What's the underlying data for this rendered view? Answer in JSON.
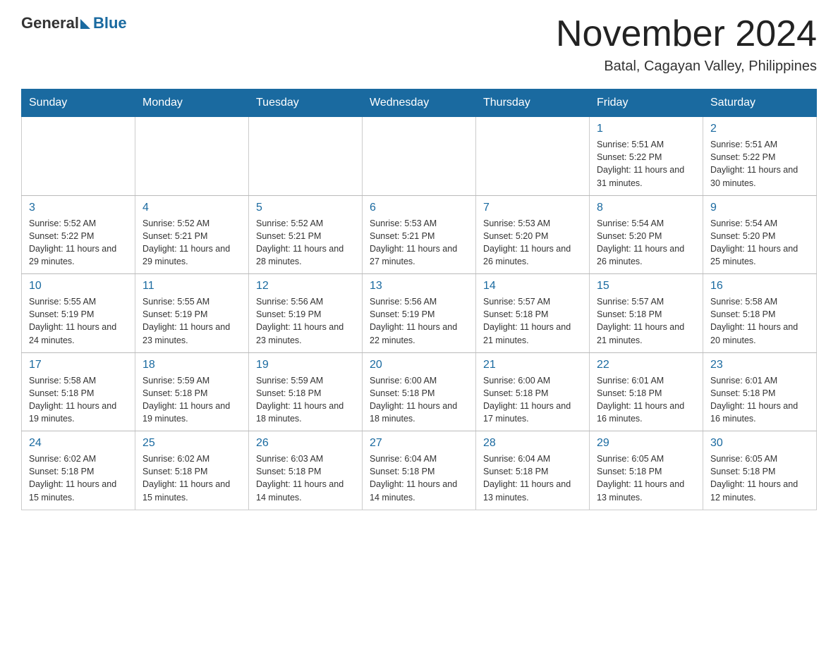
{
  "header": {
    "logo_general": "General",
    "logo_blue": "Blue",
    "month_title": "November 2024",
    "location": "Batal, Cagayan Valley, Philippines"
  },
  "days_of_week": [
    "Sunday",
    "Monday",
    "Tuesday",
    "Wednesday",
    "Thursday",
    "Friday",
    "Saturday"
  ],
  "weeks": [
    [
      {
        "day": "",
        "info": ""
      },
      {
        "day": "",
        "info": ""
      },
      {
        "day": "",
        "info": ""
      },
      {
        "day": "",
        "info": ""
      },
      {
        "day": "",
        "info": ""
      },
      {
        "day": "1",
        "info": "Sunrise: 5:51 AM\nSunset: 5:22 PM\nDaylight: 11 hours and 31 minutes."
      },
      {
        "day": "2",
        "info": "Sunrise: 5:51 AM\nSunset: 5:22 PM\nDaylight: 11 hours and 30 minutes."
      }
    ],
    [
      {
        "day": "3",
        "info": "Sunrise: 5:52 AM\nSunset: 5:22 PM\nDaylight: 11 hours and 29 minutes."
      },
      {
        "day": "4",
        "info": "Sunrise: 5:52 AM\nSunset: 5:21 PM\nDaylight: 11 hours and 29 minutes."
      },
      {
        "day": "5",
        "info": "Sunrise: 5:52 AM\nSunset: 5:21 PM\nDaylight: 11 hours and 28 minutes."
      },
      {
        "day": "6",
        "info": "Sunrise: 5:53 AM\nSunset: 5:21 PM\nDaylight: 11 hours and 27 minutes."
      },
      {
        "day": "7",
        "info": "Sunrise: 5:53 AM\nSunset: 5:20 PM\nDaylight: 11 hours and 26 minutes."
      },
      {
        "day": "8",
        "info": "Sunrise: 5:54 AM\nSunset: 5:20 PM\nDaylight: 11 hours and 26 minutes."
      },
      {
        "day": "9",
        "info": "Sunrise: 5:54 AM\nSunset: 5:20 PM\nDaylight: 11 hours and 25 minutes."
      }
    ],
    [
      {
        "day": "10",
        "info": "Sunrise: 5:55 AM\nSunset: 5:19 PM\nDaylight: 11 hours and 24 minutes."
      },
      {
        "day": "11",
        "info": "Sunrise: 5:55 AM\nSunset: 5:19 PM\nDaylight: 11 hours and 23 minutes."
      },
      {
        "day": "12",
        "info": "Sunrise: 5:56 AM\nSunset: 5:19 PM\nDaylight: 11 hours and 23 minutes."
      },
      {
        "day": "13",
        "info": "Sunrise: 5:56 AM\nSunset: 5:19 PM\nDaylight: 11 hours and 22 minutes."
      },
      {
        "day": "14",
        "info": "Sunrise: 5:57 AM\nSunset: 5:18 PM\nDaylight: 11 hours and 21 minutes."
      },
      {
        "day": "15",
        "info": "Sunrise: 5:57 AM\nSunset: 5:18 PM\nDaylight: 11 hours and 21 minutes."
      },
      {
        "day": "16",
        "info": "Sunrise: 5:58 AM\nSunset: 5:18 PM\nDaylight: 11 hours and 20 minutes."
      }
    ],
    [
      {
        "day": "17",
        "info": "Sunrise: 5:58 AM\nSunset: 5:18 PM\nDaylight: 11 hours and 19 minutes."
      },
      {
        "day": "18",
        "info": "Sunrise: 5:59 AM\nSunset: 5:18 PM\nDaylight: 11 hours and 19 minutes."
      },
      {
        "day": "19",
        "info": "Sunrise: 5:59 AM\nSunset: 5:18 PM\nDaylight: 11 hours and 18 minutes."
      },
      {
        "day": "20",
        "info": "Sunrise: 6:00 AM\nSunset: 5:18 PM\nDaylight: 11 hours and 18 minutes."
      },
      {
        "day": "21",
        "info": "Sunrise: 6:00 AM\nSunset: 5:18 PM\nDaylight: 11 hours and 17 minutes."
      },
      {
        "day": "22",
        "info": "Sunrise: 6:01 AM\nSunset: 5:18 PM\nDaylight: 11 hours and 16 minutes."
      },
      {
        "day": "23",
        "info": "Sunrise: 6:01 AM\nSunset: 5:18 PM\nDaylight: 11 hours and 16 minutes."
      }
    ],
    [
      {
        "day": "24",
        "info": "Sunrise: 6:02 AM\nSunset: 5:18 PM\nDaylight: 11 hours and 15 minutes."
      },
      {
        "day": "25",
        "info": "Sunrise: 6:02 AM\nSunset: 5:18 PM\nDaylight: 11 hours and 15 minutes."
      },
      {
        "day": "26",
        "info": "Sunrise: 6:03 AM\nSunset: 5:18 PM\nDaylight: 11 hours and 14 minutes."
      },
      {
        "day": "27",
        "info": "Sunrise: 6:04 AM\nSunset: 5:18 PM\nDaylight: 11 hours and 14 minutes."
      },
      {
        "day": "28",
        "info": "Sunrise: 6:04 AM\nSunset: 5:18 PM\nDaylight: 11 hours and 13 minutes."
      },
      {
        "day": "29",
        "info": "Sunrise: 6:05 AM\nSunset: 5:18 PM\nDaylight: 11 hours and 13 minutes."
      },
      {
        "day": "30",
        "info": "Sunrise: 6:05 AM\nSunset: 5:18 PM\nDaylight: 11 hours and 12 minutes."
      }
    ]
  ]
}
